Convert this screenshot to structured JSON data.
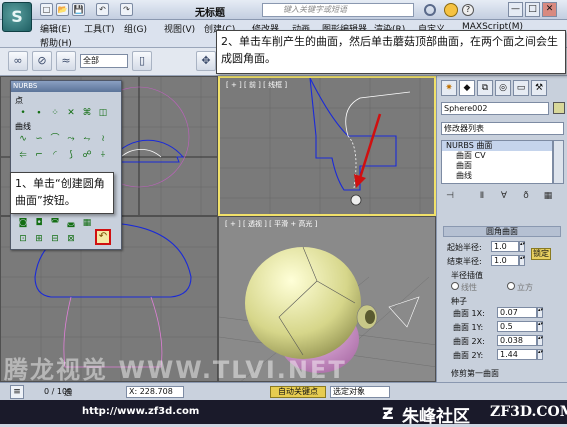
{
  "titlebar": {
    "app_logo": "S",
    "title": "无标题",
    "search_placeholder": "键入关键字或短语",
    "quick_access": [
      "□",
      "📂",
      "💾",
      "↶",
      "↷"
    ],
    "window_controls": [
      "—",
      "□",
      "✕"
    ]
  },
  "menu": {
    "items": [
      "编辑(E)",
      "工具(T)",
      "组(G)",
      "视图(V)",
      "创建(C)",
      "修改器",
      "动画",
      "图形编辑器",
      "渲染(R)",
      "自定义",
      "MAXScript(M)",
      "帮助(H)"
    ]
  },
  "toolbar": {
    "selection_filter": "全部"
  },
  "viewports": {
    "perspective_label": "[ + ] [ 透视 ] [ 平滑 + 高光 ]",
    "front_label": "[ + ] [ 前 ] [ 线框 ]"
  },
  "nurbs_panel": {
    "title": "NURBS",
    "section_points": "点",
    "section_curves": "曲线"
  },
  "callouts": {
    "step1": "1、单击“创建圆角曲面”按钮。",
    "step2": "2、单击车削产生的曲面，然后单击蘑菇顶部曲面，在两个面之间会生成圆角面。"
  },
  "command_panel": {
    "object_name": "Sphere002",
    "modifier_list": "修改器列表",
    "stack": [
      "NURBS 曲面",
      "曲面 CV",
      "曲面",
      "曲线",
      "曲线 CV"
    ],
    "rollout_title": "圆角曲面",
    "start_radius_label": "起始半径:",
    "start_radius_value": "1.0",
    "end_radius_label": "结束半径:",
    "end_radius_value": "1.0",
    "lock_label": "锁定",
    "radius_interp_label": "半径插值",
    "radio_linear": "线性",
    "radio_cubic": "立方",
    "seed_label": "种子",
    "surface1x_label": "曲面 1X:",
    "surface1x_value": "0.07",
    "surface1y_label": "曲面 1Y:",
    "surface1y_value": "0.5",
    "surface2x_label": "曲面 2X:",
    "surface2x_value": "0.038",
    "surface2y_label": "曲面 2Y:",
    "surface2y_value": "1.44",
    "trim_label": "修剪第一曲面"
  },
  "status": {
    "frame_counter": "0 / 100",
    "coord_x": "X: 228.708",
    "auto_key": "自动关键点",
    "selected_object": "选定对象",
    "select_label": "选"
  },
  "bottom_bar": {
    "url": "http://www.zf3d.com",
    "brand_cn": "朱峰社区",
    "brand_en": "ZF3D.COM",
    "watermark": "腾龙视觉 WWW.TLVI.NET"
  },
  "colors": {
    "accent_red": "#d01010",
    "wire_blue": "#1a2ad8",
    "wire_pink": "#e080d8"
  }
}
